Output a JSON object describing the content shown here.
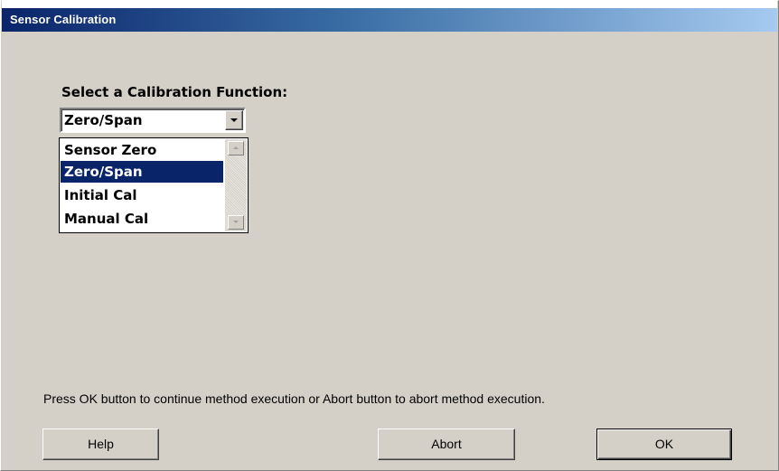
{
  "window": {
    "title": "Sensor Calibration"
  },
  "calibration": {
    "label": "Select a Calibration Function:",
    "selected_value": "Zero/Span",
    "options": [
      {
        "label": "Sensor Zero",
        "selected": false
      },
      {
        "label": "Zero/Span",
        "selected": true
      },
      {
        "label": "Initial Cal",
        "selected": false
      },
      {
        "label": "Manual Cal",
        "selected": false
      }
    ]
  },
  "message": "Press OK button to continue method execution or Abort button to abort method execution.",
  "buttons": {
    "help": "Help",
    "abort": "Abort",
    "ok": "OK"
  },
  "colors": {
    "title_start": "#0a246a",
    "title_end": "#a6caf0",
    "face": "#d4d0c8",
    "selection": "#0a246a"
  },
  "icons": {
    "combo_arrow": "chevron-down-icon",
    "scroll_up": "scroll-up-arrow-icon",
    "scroll_down": "scroll-down-arrow-icon"
  }
}
